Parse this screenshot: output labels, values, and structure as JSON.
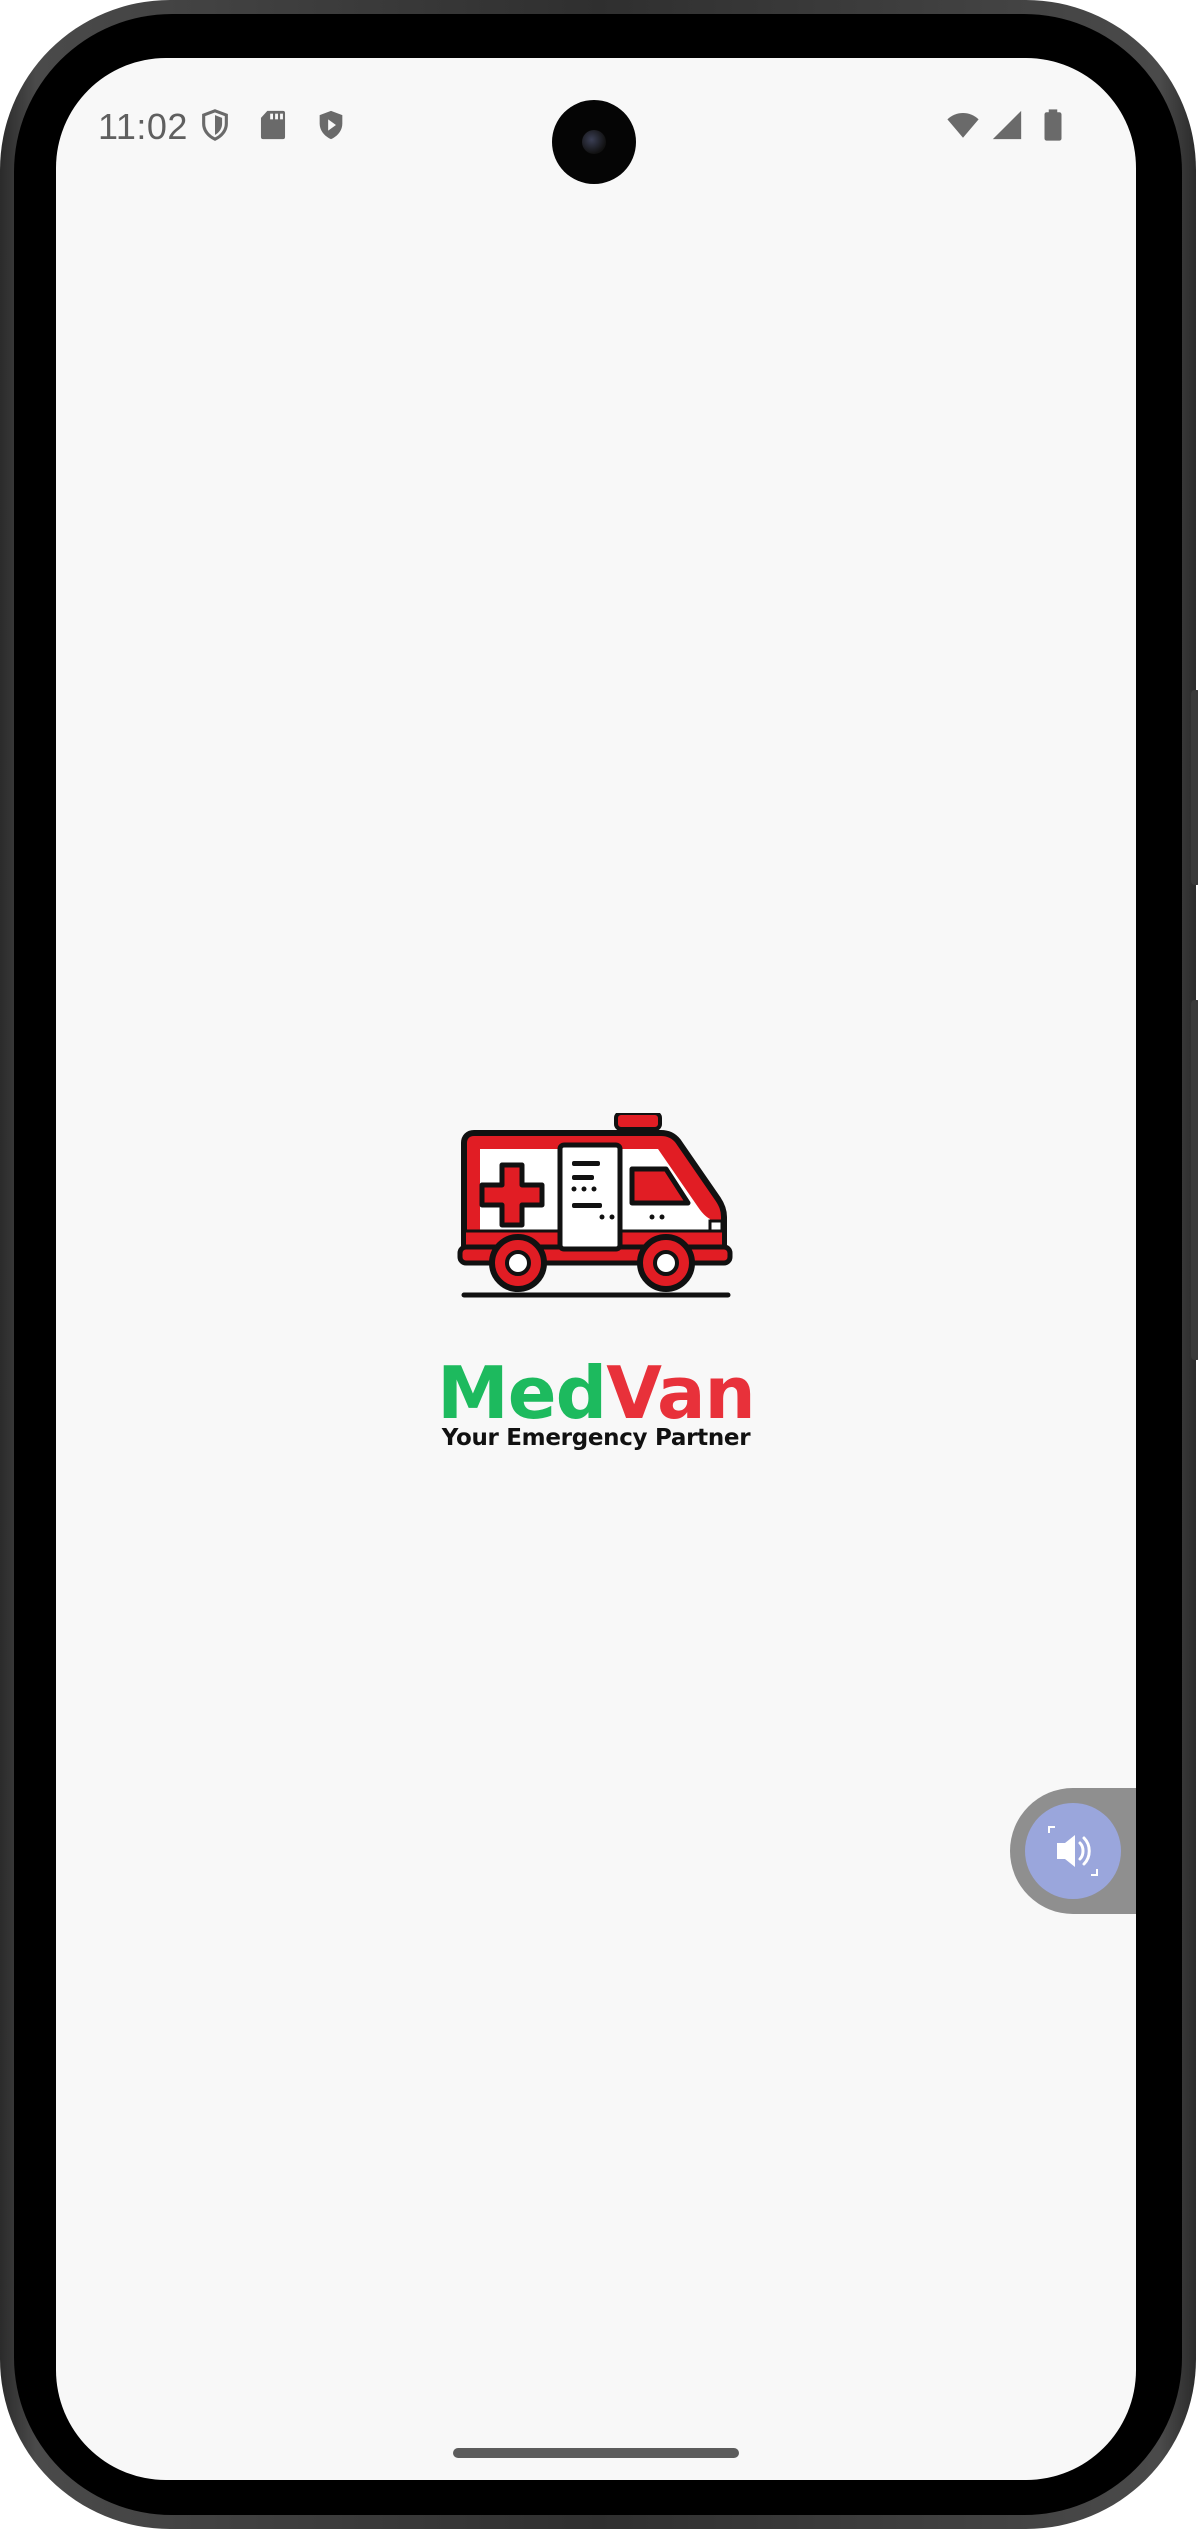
{
  "status_bar": {
    "time": "11:02",
    "left_icons": [
      "vpn-shield-icon",
      "sd-card-icon",
      "play-protect-icon"
    ],
    "right_icons": [
      "wifi-icon",
      "cell-signal-icon",
      "battery-icon"
    ]
  },
  "splash": {
    "logo_icon": "ambulance-icon",
    "brand_part1": "Med",
    "brand_part2": "Van",
    "tagline": "Your Emergency Partner"
  },
  "floating_control": {
    "icon": "volume-icon"
  },
  "colors": {
    "background": "#f8f8f8",
    "brand_green": "#1dba5e",
    "brand_red": "#e8313a",
    "float_button": "#9aa6dc"
  }
}
